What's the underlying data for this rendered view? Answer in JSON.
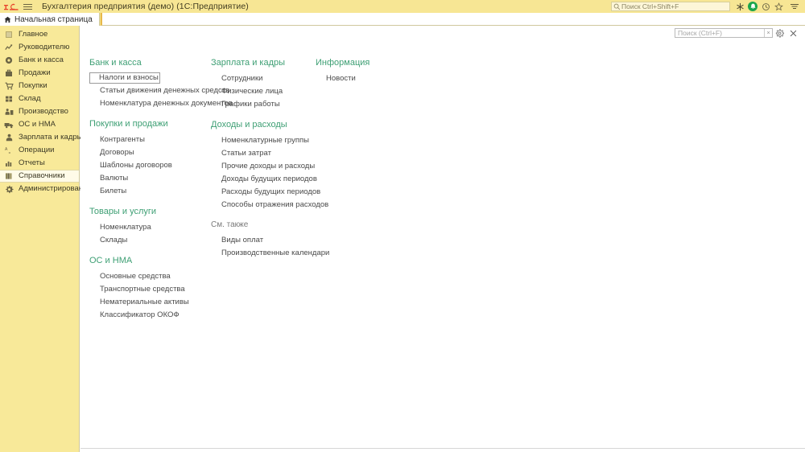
{
  "titlebar": {
    "logo_icon": "1c-logo-icon",
    "menu_icon": "hamburger-menu-icon",
    "app_title": "Бухгалтерия предприятия (демо)  (1С:Предприятие)",
    "global_search_placeholder": "Поиск Ctrl+Shift+F",
    "search_icon": "search-icon",
    "icons": [
      {
        "name": "asterisk-icon",
        "glyph": "✳"
      },
      {
        "name": "notification-bell-icon",
        "glyph": "🔔"
      },
      {
        "name": "history-clock-icon",
        "glyph": "🕘"
      },
      {
        "name": "favorites-star-icon",
        "glyph": "☆"
      },
      {
        "name": "main-menu-icon",
        "glyph": "≡"
      }
    ]
  },
  "tabs": [
    {
      "label": "Начальная страница",
      "icon": "home-icon",
      "active": true
    }
  ],
  "sidebar": {
    "items": [
      {
        "label": "Главное",
        "icon": "list-icon"
      },
      {
        "label": "Руководителю",
        "icon": "chart-trend-icon"
      },
      {
        "label": "Банк и касса",
        "icon": "coin-icon"
      },
      {
        "label": "Продажи",
        "icon": "briefcase-icon"
      },
      {
        "label": "Покупки",
        "icon": "cart-icon"
      },
      {
        "label": "Склад",
        "icon": "warehouse-icon"
      },
      {
        "label": "Производство",
        "icon": "factory-icon"
      },
      {
        "label": "ОС и НМА",
        "icon": "truck-icon"
      },
      {
        "label": "Зарплата и кадры",
        "icon": "person-icon"
      },
      {
        "label": "Операции",
        "icon": "operations-icon"
      },
      {
        "label": "Отчеты",
        "icon": "bar-chart-icon"
      },
      {
        "label": "Справочники",
        "icon": "books-icon",
        "selected": true
      },
      {
        "label": "Администрирование",
        "icon": "gear-icon"
      }
    ]
  },
  "content_search": {
    "placeholder": "Поиск (Ctrl+F)",
    "clear_label": "×",
    "gear_icon": "gear-icon",
    "close_icon": "close-icon"
  },
  "columns": [
    {
      "groups": [
        {
          "title": "Банк и касса",
          "links": [
            {
              "label": "Налоги и взносы",
              "focused": true
            },
            {
              "label": "Статьи движения денежных средств"
            },
            {
              "label": "Номенклатура денежных документов"
            }
          ]
        },
        {
          "title": "Покупки и продажи",
          "links": [
            {
              "label": "Контрагенты"
            },
            {
              "label": "Договоры"
            },
            {
              "label": "Шаблоны договоров"
            },
            {
              "label": "Валюты"
            },
            {
              "label": "Билеты"
            }
          ]
        },
        {
          "title": "Товары и услуги",
          "links": [
            {
              "label": "Номенклатура"
            },
            {
              "label": "Склады"
            }
          ]
        },
        {
          "title": "ОС и НМА",
          "links": [
            {
              "label": "Основные средства"
            },
            {
              "label": "Транспортные средства"
            },
            {
              "label": "Нематериальные активы"
            },
            {
              "label": "Классификатор ОКОФ"
            }
          ]
        }
      ]
    },
    {
      "groups": [
        {
          "title": "Зарплата и кадры",
          "links": [
            {
              "label": "Сотрудники"
            },
            {
              "label": "Физические лица"
            },
            {
              "label": "Графики работы"
            }
          ]
        },
        {
          "title": "Доходы и расходы",
          "links": [
            {
              "label": "Номенклатурные группы"
            },
            {
              "label": "Статьи затрат"
            },
            {
              "label": "Прочие доходы и расходы"
            },
            {
              "label": "Доходы будущих периодов"
            },
            {
              "label": "Расходы будущих периодов"
            },
            {
              "label": "Способы отражения расходов"
            }
          ]
        },
        {
          "title": "См. также",
          "plain": true,
          "links": [
            {
              "label": "Виды оплат"
            },
            {
              "label": "Производственные календари"
            }
          ]
        }
      ]
    },
    {
      "groups": [
        {
          "title": "Информация",
          "links": [
            {
              "label": "Новости"
            }
          ]
        }
      ]
    }
  ],
  "colors": {
    "titlebar": "#f7e694",
    "tabbar": "#f2e188",
    "sidebar": "#f8e999",
    "group_heading": "#3e9f74",
    "bell_green": "#1aa64b",
    "logo_red": "#e8412a"
  }
}
